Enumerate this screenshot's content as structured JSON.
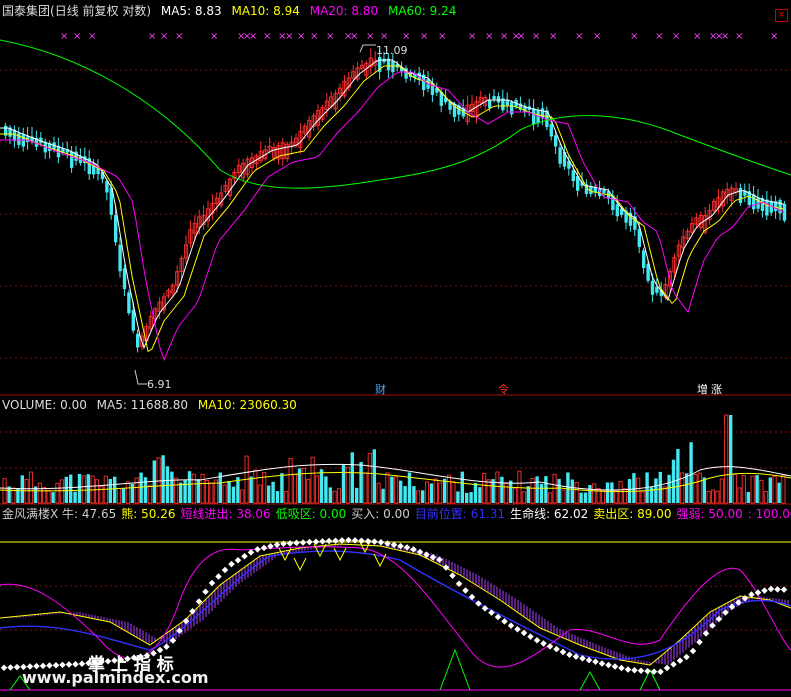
{
  "main": {
    "security": "国泰集团",
    "period": "(日线 前复权 对数)",
    "ma5": {
      "label": "MA5:",
      "value": "8.83",
      "color": "#ffffff"
    },
    "ma10": {
      "label": "MA10:",
      "value": "8.94",
      "color": "#ffff00"
    },
    "ma20": {
      "label": "MA20:",
      "value": "8.80",
      "color": "#ff00ff"
    },
    "ma60": {
      "label": "MA60:",
      "value": "9.24",
      "color": "#00ff00"
    },
    "high_label": "11.09",
    "low_label": "6.91",
    "events": [
      {
        "text": "财",
        "color": "#44aaff"
      },
      {
        "text": "令",
        "color": "#ff3030"
      },
      {
        "text": "增",
        "color": "#ffffff"
      },
      {
        "text": "涨",
        "color": "#ffffff"
      }
    ],
    "marker": "×"
  },
  "volume": {
    "name": "VOLUME:",
    "value": "0.00",
    "ma5": {
      "label": "MA5:",
      "value": "11688.80",
      "color": "#ffffff"
    },
    "ma10": {
      "label": "MA10:",
      "value": "23060.30",
      "color": "#ffff00"
    }
  },
  "indicator": {
    "items": [
      {
        "label": "金风满楼X 牛:",
        "value": "47.65",
        "color": "#cccccc"
      },
      {
        "label": "熊:",
        "value": "50.26",
        "color": "#ffff00"
      },
      {
        "label": "短线进出:",
        "value": "38.06",
        "color": "#ff00ff"
      },
      {
        "label": "低吸区:",
        "value": "0.00",
        "color": "#00ff00"
      },
      {
        "label": "买入:",
        "value": "0.00",
        "color": "#cccccc"
      },
      {
        "label": "目前位置:",
        "value": "61.31",
        "color": "#3030ff"
      },
      {
        "label": "生命线:",
        "value": "62.02",
        "color": "#ffffff"
      },
      {
        "label": "卖出区:",
        "value": "89.00",
        "color": "#ffff00"
      },
      {
        "label": "强弱:",
        "value": "50.00",
        "color": "#ff00ff"
      },
      {
        "label": ":",
        "value": "100.00",
        "color": "#ff00ff"
      }
    ]
  },
  "watermark": {
    "cn": "掌 上 指 标",
    "url": "www.palmindex.com"
  },
  "colors": {
    "up": "#ff3030",
    "down": "#44e8f0",
    "grid": "#8a1010"
  }
}
